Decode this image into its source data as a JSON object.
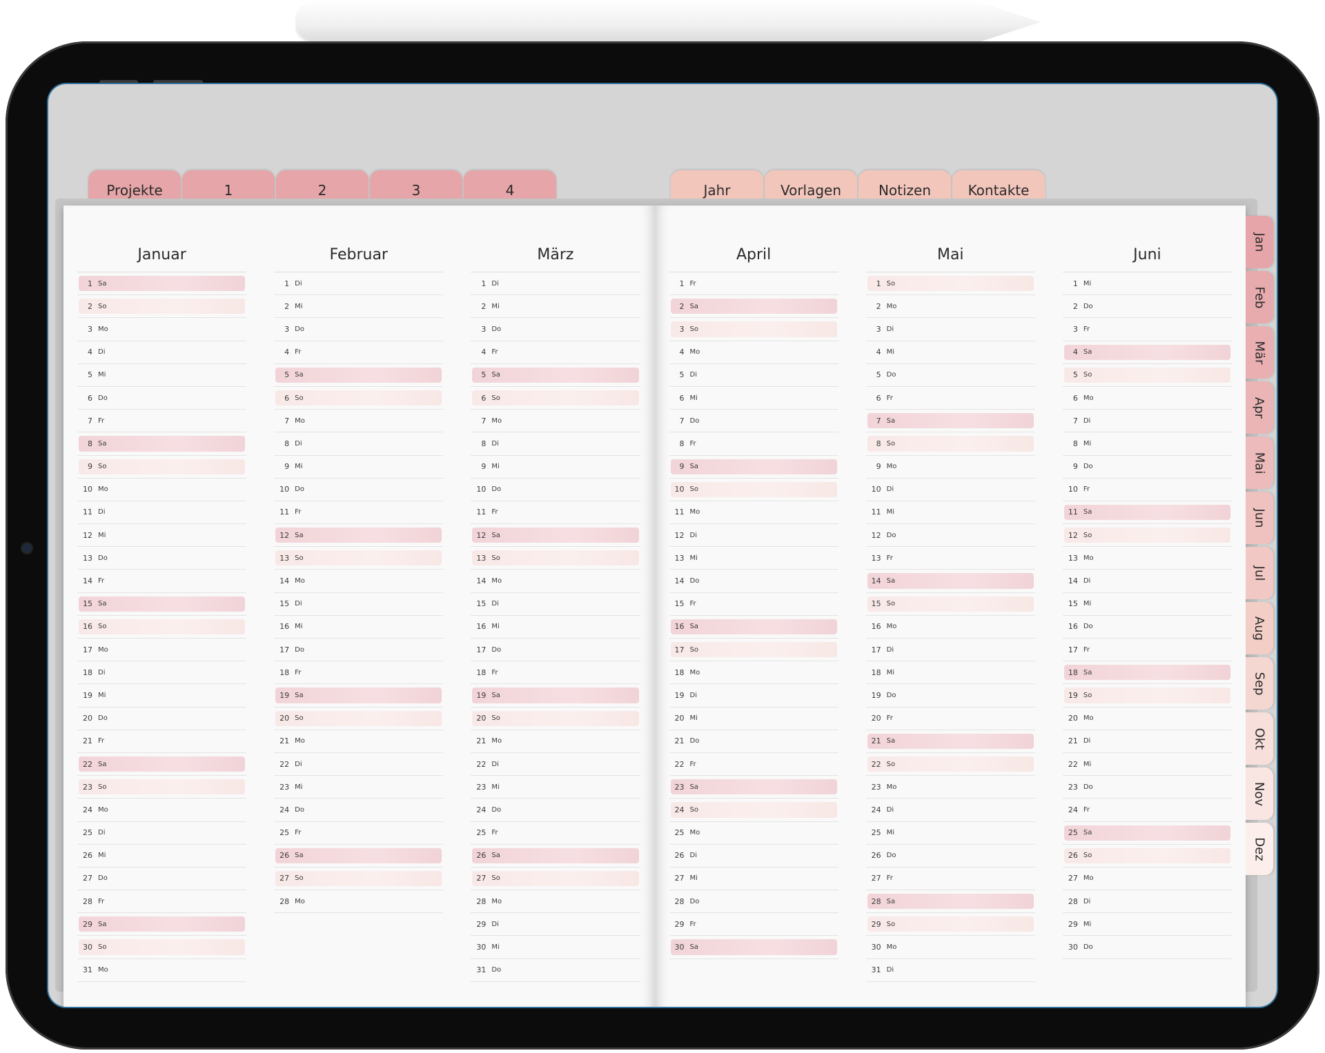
{
  "top_tabs_left": [
    "Projekte",
    "1",
    "2",
    "3",
    "4"
  ],
  "top_tabs_right": [
    "Jahr",
    "Vorlagen",
    "Notizen",
    "Kontakte"
  ],
  "side_tabs": [
    "Jan",
    "Feb",
    "Mär",
    "Apr",
    "Mai",
    "Jun",
    "Jul",
    "Aug",
    "Sep",
    "Okt",
    "Nov",
    "Dez"
  ],
  "colors": {
    "tab_left": "#e6a5a8",
    "tab_right": "#f3c6bc",
    "weekend_saturday": "#f2d4d8",
    "weekend_sunday": "#f8e9e7",
    "page": "#f9f9f9",
    "frame": "#0c0c0c"
  },
  "months": [
    {
      "name": "Januar",
      "days": [
        [
          "1",
          "Sa"
        ],
        [
          "2",
          "So"
        ],
        [
          "3",
          "Mo"
        ],
        [
          "4",
          "Di"
        ],
        [
          "5",
          "Mi"
        ],
        [
          "6",
          "Do"
        ],
        [
          "7",
          "Fr"
        ],
        [
          "8",
          "Sa"
        ],
        [
          "9",
          "So"
        ],
        [
          "10",
          "Mo"
        ],
        [
          "11",
          "Di"
        ],
        [
          "12",
          "Mi"
        ],
        [
          "13",
          "Do"
        ],
        [
          "14",
          "Fr"
        ],
        [
          "15",
          "Sa"
        ],
        [
          "16",
          "So"
        ],
        [
          "17",
          "Mo"
        ],
        [
          "18",
          "Di"
        ],
        [
          "19",
          "Mi"
        ],
        [
          "20",
          "Do"
        ],
        [
          "21",
          "Fr"
        ],
        [
          "22",
          "Sa"
        ],
        [
          "23",
          "So"
        ],
        [
          "24",
          "Mo"
        ],
        [
          "25",
          "Di"
        ],
        [
          "26",
          "Mi"
        ],
        [
          "27",
          "Do"
        ],
        [
          "28",
          "Fr"
        ],
        [
          "29",
          "Sa"
        ],
        [
          "30",
          "So"
        ],
        [
          "31",
          "Mo"
        ]
      ]
    },
    {
      "name": "Februar",
      "days": [
        [
          "1",
          "Di"
        ],
        [
          "2",
          "Mi"
        ],
        [
          "3",
          "Do"
        ],
        [
          "4",
          "Fr"
        ],
        [
          "5",
          "Sa"
        ],
        [
          "6",
          "So"
        ],
        [
          "7",
          "Mo"
        ],
        [
          "8",
          "Di"
        ],
        [
          "9",
          "Mi"
        ],
        [
          "10",
          "Do"
        ],
        [
          "11",
          "Fr"
        ],
        [
          "12",
          "Sa"
        ],
        [
          "13",
          "So"
        ],
        [
          "14",
          "Mo"
        ],
        [
          "15",
          "Di"
        ],
        [
          "16",
          "Mi"
        ],
        [
          "17",
          "Do"
        ],
        [
          "18",
          "Fr"
        ],
        [
          "19",
          "Sa"
        ],
        [
          "20",
          "So"
        ],
        [
          "21",
          "Mo"
        ],
        [
          "22",
          "Di"
        ],
        [
          "23",
          "Mi"
        ],
        [
          "24",
          "Do"
        ],
        [
          "25",
          "Fr"
        ],
        [
          "26",
          "Sa"
        ],
        [
          "27",
          "So"
        ],
        [
          "28",
          "Mo"
        ]
      ]
    },
    {
      "name": "März",
      "days": [
        [
          "1",
          "Di"
        ],
        [
          "2",
          "Mi"
        ],
        [
          "3",
          "Do"
        ],
        [
          "4",
          "Fr"
        ],
        [
          "5",
          "Sa"
        ],
        [
          "6",
          "So"
        ],
        [
          "7",
          "Mo"
        ],
        [
          "8",
          "Di"
        ],
        [
          "9",
          "Mi"
        ],
        [
          "10",
          "Do"
        ],
        [
          "11",
          "Fr"
        ],
        [
          "12",
          "Sa"
        ],
        [
          "13",
          "So"
        ],
        [
          "14",
          "Mo"
        ],
        [
          "15",
          "Di"
        ],
        [
          "16",
          "Mi"
        ],
        [
          "17",
          "Do"
        ],
        [
          "18",
          "Fr"
        ],
        [
          "19",
          "Sa"
        ],
        [
          "20",
          "So"
        ],
        [
          "21",
          "Mo"
        ],
        [
          "22",
          "Di"
        ],
        [
          "23",
          "Mi"
        ],
        [
          "24",
          "Do"
        ],
        [
          "25",
          "Fr"
        ],
        [
          "26",
          "Sa"
        ],
        [
          "27",
          "So"
        ],
        [
          "28",
          "Mo"
        ],
        [
          "29",
          "Di"
        ],
        [
          "30",
          "Mi"
        ],
        [
          "31",
          "Do"
        ]
      ]
    },
    {
      "name": "April",
      "days": [
        [
          "1",
          "Fr"
        ],
        [
          "2",
          "Sa"
        ],
        [
          "3",
          "So"
        ],
        [
          "4",
          "Mo"
        ],
        [
          "5",
          "Di"
        ],
        [
          "6",
          "Mi"
        ],
        [
          "7",
          "Do"
        ],
        [
          "8",
          "Fr"
        ],
        [
          "9",
          "Sa"
        ],
        [
          "10",
          "So"
        ],
        [
          "11",
          "Mo"
        ],
        [
          "12",
          "Di"
        ],
        [
          "13",
          "Mi"
        ],
        [
          "14",
          "Do"
        ],
        [
          "15",
          "Fr"
        ],
        [
          "16",
          "Sa"
        ],
        [
          "17",
          "So"
        ],
        [
          "18",
          "Mo"
        ],
        [
          "19",
          "Di"
        ],
        [
          "20",
          "Mi"
        ],
        [
          "21",
          "Do"
        ],
        [
          "22",
          "Fr"
        ],
        [
          "23",
          "Sa"
        ],
        [
          "24",
          "So"
        ],
        [
          "25",
          "Mo"
        ],
        [
          "26",
          "Di"
        ],
        [
          "27",
          "Mi"
        ],
        [
          "28",
          "Do"
        ],
        [
          "29",
          "Fr"
        ],
        [
          "30",
          "Sa"
        ]
      ]
    },
    {
      "name": "Mai",
      "days": [
        [
          "1",
          "So"
        ],
        [
          "2",
          "Mo"
        ],
        [
          "3",
          "Di"
        ],
        [
          "4",
          "Mi"
        ],
        [
          "5",
          "Do"
        ],
        [
          "6",
          "Fr"
        ],
        [
          "7",
          "Sa"
        ],
        [
          "8",
          "So"
        ],
        [
          "9",
          "Mo"
        ],
        [
          "10",
          "Di"
        ],
        [
          "11",
          "Mi"
        ],
        [
          "12",
          "Do"
        ],
        [
          "13",
          "Fr"
        ],
        [
          "14",
          "Sa"
        ],
        [
          "15",
          "So"
        ],
        [
          "16",
          "Mo"
        ],
        [
          "17",
          "Di"
        ],
        [
          "18",
          "Mi"
        ],
        [
          "19",
          "Do"
        ],
        [
          "20",
          "Fr"
        ],
        [
          "21",
          "Sa"
        ],
        [
          "22",
          "So"
        ],
        [
          "23",
          "Mo"
        ],
        [
          "24",
          "Di"
        ],
        [
          "25",
          "Mi"
        ],
        [
          "26",
          "Do"
        ],
        [
          "27",
          "Fr"
        ],
        [
          "28",
          "Sa"
        ],
        [
          "29",
          "So"
        ],
        [
          "30",
          "Mo"
        ],
        [
          "31",
          "Di"
        ]
      ]
    },
    {
      "name": "Juni",
      "days": [
        [
          "1",
          "Mi"
        ],
        [
          "2",
          "Do"
        ],
        [
          "3",
          "Fr"
        ],
        [
          "4",
          "Sa"
        ],
        [
          "5",
          "So"
        ],
        [
          "6",
          "Mo"
        ],
        [
          "7",
          "Di"
        ],
        [
          "8",
          "Mi"
        ],
        [
          "9",
          "Do"
        ],
        [
          "10",
          "Fr"
        ],
        [
          "11",
          "Sa"
        ],
        [
          "12",
          "So"
        ],
        [
          "13",
          "Mo"
        ],
        [
          "14",
          "Di"
        ],
        [
          "15",
          "Mi"
        ],
        [
          "16",
          "Do"
        ],
        [
          "17",
          "Fr"
        ],
        [
          "18",
          "Sa"
        ],
        [
          "19",
          "So"
        ],
        [
          "20",
          "Mo"
        ],
        [
          "21",
          "Di"
        ],
        [
          "22",
          "Mi"
        ],
        [
          "23",
          "Do"
        ],
        [
          "24",
          "Fr"
        ],
        [
          "25",
          "Sa"
        ],
        [
          "26",
          "So"
        ],
        [
          "27",
          "Mo"
        ],
        [
          "28",
          "Di"
        ],
        [
          "29",
          "Mi"
        ],
        [
          "30",
          "Do"
        ]
      ]
    }
  ]
}
